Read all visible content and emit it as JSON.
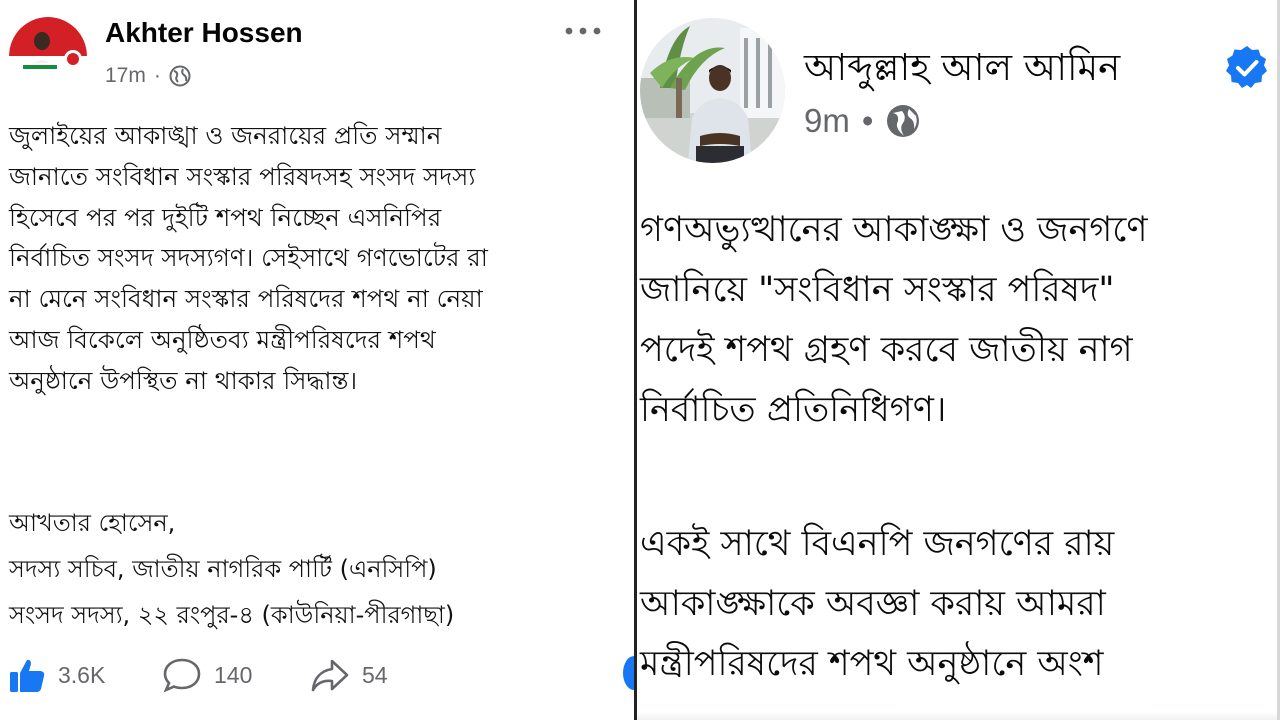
{
  "left_post": {
    "author": "Akhter Hossen",
    "timestamp": "17m",
    "privacy_icon": "globe-icon",
    "more_icon": "more-options-icon",
    "body_lines": [
      "জুলাইয়ের আকাঙ্খা ও জনরায়ের প্রতি সম্মান",
      "জানাতে সংবিধান সংস্কার পরিষদসহ সংসদ সদস্য",
      "হিসেবে পর পর দুইটি শপথ নিচ্ছেন এসনিপির",
      "নির্বাচিত সংসদ সদস্যগণ। সেইসাথে গণভোটের রা",
      "না মেনে সংবিধান সংস্কার পরিষদের শপথ না নেয়া",
      "আজ বিকেলে অনুষ্ঠিতব্য মন্ত্রীপরিষদের শপথ",
      "অনুষ্ঠানে উপস্থিত না থাকার সিদ্ধান্ত।"
    ],
    "signature_lines": [
      "আখতার হোসেন,",
      "সদস্য সচিব, জাতীয় নাগরিক পার্টি (এনসিপি)",
      "সংসদ সদস্য, ২২ রংপুর-৪ (কাউনিয়া-পীরগাছা)"
    ],
    "reactions": {
      "likes": "3.6K",
      "comments": "140",
      "shares": "54"
    }
  },
  "right_post": {
    "author": "আব্দুল্লাহ আল আমিন",
    "timestamp": "9m",
    "verified_icon": "verified-badge-icon",
    "privacy_icon": "globe-icon",
    "body_lines": [
      "গণঅভ্যুত্থানের আকাঙ্ক্ষা ও জনগণে",
      "জানিয়ে \"সংবিধান সংস্কার পরিষদ\"",
      "পদেই শপথ গ্রহণ করবে জাতীয় নাগ",
      "নির্বাচিত প্রতিনিধিগণ।"
    ],
    "body_lines_2": [
      "একই সাথে বিএনপি জনগণের রায়",
      "আকাঙ্ক্ষাকে অবজ্ঞা করায় আমরা",
      "মন্ত্রীপরিষদের শপথ অনুষ্ঠানে অংশ"
    ]
  },
  "colors": {
    "facebook_blue": "#1877f2",
    "meta_gray": "#65676b",
    "avatar_red": "#d32027",
    "avatar_green": "#1a8d3c"
  }
}
